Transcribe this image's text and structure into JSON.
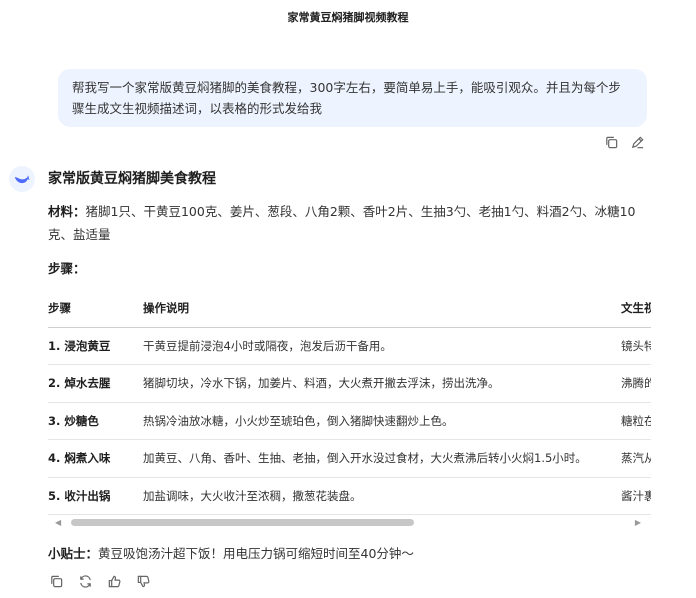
{
  "header": {
    "title": "家常黄豆焖猪脚视频教程"
  },
  "user_message": {
    "text": "帮我写一个家常版黄豆焖猪脚的美食教程，300字左右，要简单易上手，能吸引观众。并且为每个步骤生成文生视频描述词，以表格的形式发给我"
  },
  "message_actions": {
    "copy_icon": "copy-icon",
    "edit_icon": "edit-icon"
  },
  "answer": {
    "title": "家常版黄豆焖猪脚美食教程",
    "materials_label": "材料：",
    "materials_text": "猪脚1只、干黄豆100克、姜片、葱段、八角2颗、香叶2片、生抽3勺、老抽1勺、料酒2勺、冰糖10克、盐适量",
    "steps_label": "步骤："
  },
  "table": {
    "headers": [
      "步骤",
      "操作说明",
      "文生视频描述词"
    ],
    "rows": [
      {
        "step": "1. 浸泡黄豆",
        "desc": "干黄豆提前浸泡4小时或隔夜，泡发后沥干备用。",
        "video": "镜头特写黄豆在清水中浸泡"
      },
      {
        "step": "2. 焯水去腥",
        "desc": "猪脚切块，冷水下锅，加姜片、料酒，大火煮开撇去浮沫，捞出洗净。",
        "video": "沸腾的锅中猪脚翻滚"
      },
      {
        "step": "3. 炒糖色",
        "desc": "热锅冷油放冰糖，小火炒至琥珀色，倒入猪脚快速翻炒上色。",
        "video": "糖粒在热油中融化冒泡"
      },
      {
        "step": "4. 焖煮入味",
        "desc": "加黄豆、八角、香叶、生抽、老抽，倒入开水没过食材，大火煮沸后转小火焖1.5小时。",
        "video": "蒸汽从锅盖边缘冒出"
      },
      {
        "step": "5. 收汁出锅",
        "desc": "加盐调味，大火收汁至浓稠，撒葱花装盘。",
        "video": "酱汁裹满猪脚特写"
      }
    ]
  },
  "tip": {
    "label": "小贴士：",
    "text": "黄豆吸饱汤汁超下饭！用电压力锅可缩短时间至40分钟～"
  },
  "scrollbar": {
    "left_arrow": "◀",
    "right_arrow": "▶"
  }
}
